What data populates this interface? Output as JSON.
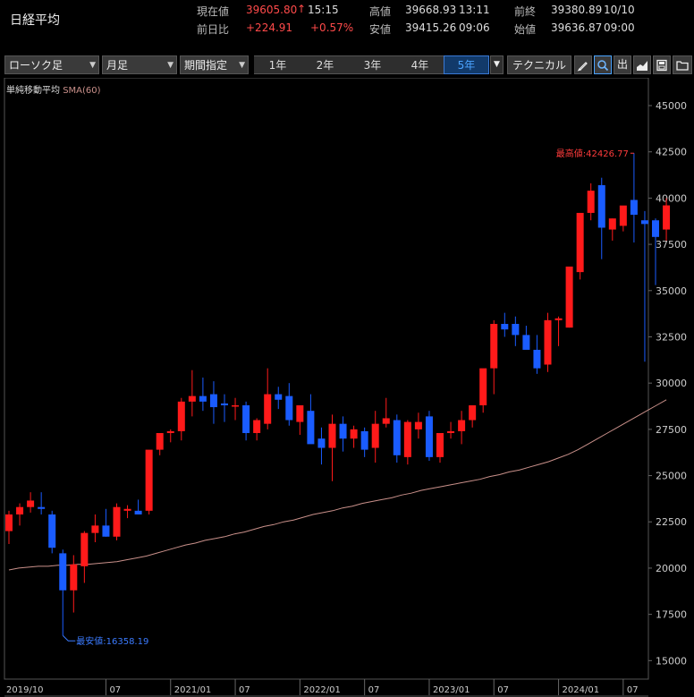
{
  "header": {
    "title": "日経平均",
    "current_label": "現在値",
    "current_value": "39605.80",
    "current_arrow": "↑",
    "current_time": "15:15",
    "change_label": "前日比",
    "change_value": "+224.91",
    "change_pct": "+0.57%",
    "high_label": "高値",
    "high_value": "39668.93",
    "high_time": "13:11",
    "low_label": "安値",
    "low_value": "39415.26",
    "low_time": "09:06",
    "prev_label": "前終",
    "prev_value": "39380.89",
    "prev_date": "10/10",
    "open_label": "始値",
    "open_value": "39636.87",
    "open_time": "09:00"
  },
  "toolbar": {
    "chart_type": "ローソク足",
    "interval": "月足",
    "range_mode": "期間指定",
    "periods": [
      "1年",
      "2年",
      "3年",
      "4年",
      "5年"
    ],
    "active_period": "5年",
    "technical": "テクニカル",
    "icons": [
      "pencil-icon",
      "zoom-icon",
      "volume-icon",
      "area-chart-icon",
      "save-icon",
      "folder-icon"
    ],
    "volume_glyph": "出"
  },
  "colors": {
    "up": "#ff1a1a",
    "down": "#1a5cff",
    "sma": "#c9908a",
    "max_label": "#ff3b3b",
    "min_label": "#3b7bff",
    "grid": "#333333"
  },
  "chart_data": {
    "type": "candlestick",
    "indicator": {
      "label": "単純移動平均",
      "name": "SMA(60)",
      "values": [
        19900,
        20000,
        20050,
        20100,
        20100,
        20150,
        20150,
        20200,
        20200,
        20250,
        20300,
        20350,
        20450,
        20550,
        20650,
        20800,
        20950,
        21100,
        21250,
        21350,
        21500,
        21600,
        21700,
        21850,
        21950,
        22100,
        22250,
        22350,
        22500,
        22600,
        22750,
        22900,
        23000,
        23100,
        23250,
        23350,
        23500,
        23600,
        23700,
        23800,
        23950,
        24050,
        24200,
        24300,
        24400,
        24500,
        24600,
        24700,
        24800,
        24950,
        25050,
        25200,
        25300,
        25450,
        25600,
        25750,
        25950,
        26150,
        26400,
        26700,
        27000,
        27300,
        27600,
        27900,
        28200,
        28500,
        28800,
        29100
      ]
    },
    "candles": [
      {
        "o": 22000,
        "h": 23100,
        "l": 21300,
        "c": 22900
      },
      {
        "o": 22900,
        "h": 23500,
        "l": 22300,
        "c": 23300
      },
      {
        "o": 23300,
        "h": 24100,
        "l": 23000,
        "c": 23650
      },
      {
        "o": 23300,
        "h": 24100,
        "l": 22900,
        "c": 23200
      },
      {
        "o": 22900,
        "h": 23100,
        "l": 20800,
        "c": 21100
      },
      {
        "o": 20800,
        "h": 21000,
        "l": 16358,
        "c": 18800
      },
      {
        "o": 18800,
        "h": 20700,
        "l": 17600,
        "c": 20200
      },
      {
        "o": 20100,
        "h": 22000,
        "l": 19200,
        "c": 21900
      },
      {
        "o": 21900,
        "h": 22900,
        "l": 21400,
        "c": 22300
      },
      {
        "o": 22300,
        "h": 23200,
        "l": 21700,
        "c": 21700
      },
      {
        "o": 21700,
        "h": 23500,
        "l": 21500,
        "c": 23300
      },
      {
        "o": 23100,
        "h": 23400,
        "l": 22700,
        "c": 23200
      },
      {
        "o": 23100,
        "h": 23700,
        "l": 22900,
        "c": 22900
      },
      {
        "o": 23100,
        "h": 26000,
        "l": 22900,
        "c": 26400
      },
      {
        "o": 26400,
        "h": 27300,
        "l": 26100,
        "c": 27300
      },
      {
        "o": 27300,
        "h": 27500,
        "l": 26800,
        "c": 27400
      },
      {
        "o": 27400,
        "h": 29200,
        "l": 26900,
        "c": 29000
      },
      {
        "o": 29000,
        "h": 30700,
        "l": 28200,
        "c": 29300
      },
      {
        "o": 29300,
        "h": 30300,
        "l": 28500,
        "c": 29000
      },
      {
        "o": 29400,
        "h": 30100,
        "l": 27800,
        "c": 28700
      },
      {
        "o": 28900,
        "h": 29400,
        "l": 27900,
        "c": 28800
      },
      {
        "o": 28800,
        "h": 29200,
        "l": 28000,
        "c": 28800
      },
      {
        "o": 28800,
        "h": 29000,
        "l": 26900,
        "c": 27300
      },
      {
        "o": 27300,
        "h": 28100,
        "l": 26900,
        "c": 28000
      },
      {
        "o": 27800,
        "h": 30800,
        "l": 27500,
        "c": 29400
      },
      {
        "o": 29400,
        "h": 29800,
        "l": 28600,
        "c": 29100
      },
      {
        "o": 29300,
        "h": 30000,
        "l": 27700,
        "c": 28000
      },
      {
        "o": 27900,
        "h": 28600,
        "l": 27200,
        "c": 28800
      },
      {
        "o": 28500,
        "h": 29400,
        "l": 26900,
        "c": 26700
      },
      {
        "o": 27000,
        "h": 27600,
        "l": 25600,
        "c": 26500
      },
      {
        "o": 26500,
        "h": 28300,
        "l": 24700,
        "c": 27800
      },
      {
        "o": 27800,
        "h": 28200,
        "l": 26300,
        "c": 27000
      },
      {
        "o": 27000,
        "h": 27700,
        "l": 26500,
        "c": 27500
      },
      {
        "o": 27400,
        "h": 27600,
        "l": 26000,
        "c": 26400
      },
      {
        "o": 26500,
        "h": 28500,
        "l": 25700,
        "c": 27800
      },
      {
        "o": 27800,
        "h": 29200,
        "l": 27600,
        "c": 28100
      },
      {
        "o": 28000,
        "h": 28300,
        "l": 25700,
        "c": 26100
      },
      {
        "o": 26000,
        "h": 28000,
        "l": 25600,
        "c": 27900
      },
      {
        "o": 27500,
        "h": 28400,
        "l": 27000,
        "c": 27900
      },
      {
        "o": 28200,
        "h": 28500,
        "l": 25800,
        "c": 26000
      },
      {
        "o": 26000,
        "h": 27200,
        "l": 25700,
        "c": 27300
      },
      {
        "o": 27300,
        "h": 27900,
        "l": 27000,
        "c": 27400
      },
      {
        "o": 27400,
        "h": 28500,
        "l": 26700,
        "c": 28000
      },
      {
        "o": 28000,
        "h": 28800,
        "l": 27600,
        "c": 28800
      },
      {
        "o": 28800,
        "h": 30500,
        "l": 28400,
        "c": 30800
      },
      {
        "o": 30800,
        "h": 33400,
        "l": 29400,
        "c": 33200
      },
      {
        "o": 33200,
        "h": 33800,
        "l": 32500,
        "c": 32900
      },
      {
        "o": 33200,
        "h": 33600,
        "l": 32000,
        "c": 32600
      },
      {
        "o": 32600,
        "h": 33100,
        "l": 31900,
        "c": 31800
      },
      {
        "o": 31800,
        "h": 32600,
        "l": 30500,
        "c": 30800
      },
      {
        "o": 31000,
        "h": 33800,
        "l": 30600,
        "c": 33400
      },
      {
        "o": 33400,
        "h": 33600,
        "l": 32000,
        "c": 33500
      },
      {
        "o": 33000,
        "h": 33800,
        "l": 33000,
        "c": 36300
      },
      {
        "o": 36000,
        "h": 39200,
        "l": 35600,
        "c": 39200
      },
      {
        "o": 39200,
        "h": 40800,
        "l": 38800,
        "c": 40400
      },
      {
        "o": 40700,
        "h": 41100,
        "l": 36700,
        "c": 38400
      },
      {
        "o": 38300,
        "h": 38900,
        "l": 37700,
        "c": 38900
      },
      {
        "o": 38500,
        "h": 39500,
        "l": 38200,
        "c": 39600
      },
      {
        "o": 39900,
        "h": 42426.77,
        "l": 37600,
        "c": 39100
      },
      {
        "o": 38800,
        "h": 39300,
        "l": 31156,
        "c": 38600
      },
      {
        "o": 38800,
        "h": 38900,
        "l": 35300,
        "c": 37900
      },
      {
        "o": 38300,
        "h": 40000,
        "l": 37700,
        "c": 39605.8
      }
    ],
    "ylim": [
      14000,
      46500
    ],
    "y_ticks": [
      15000,
      17500,
      20000,
      22500,
      25000,
      27500,
      30000,
      32500,
      35000,
      37500,
      40000,
      42500,
      45000
    ],
    "x_labels": [
      {
        "i": 0,
        "t": "2019/10"
      },
      {
        "i": 9,
        "t": "07"
      },
      {
        "i": 15,
        "t": "2021/01"
      },
      {
        "i": 21,
        "t": "07"
      },
      {
        "i": 27,
        "t": "2022/01"
      },
      {
        "i": 33,
        "t": "07"
      },
      {
        "i": 39,
        "t": "2023/01"
      },
      {
        "i": 45,
        "t": "07"
      },
      {
        "i": 51,
        "t": "2024/01"
      },
      {
        "i": 57,
        "t": "07"
      }
    ],
    "x_label_first": "2019/10",
    "max_label": "最高値:42426.77",
    "min_label": "最安値:16358.19"
  }
}
